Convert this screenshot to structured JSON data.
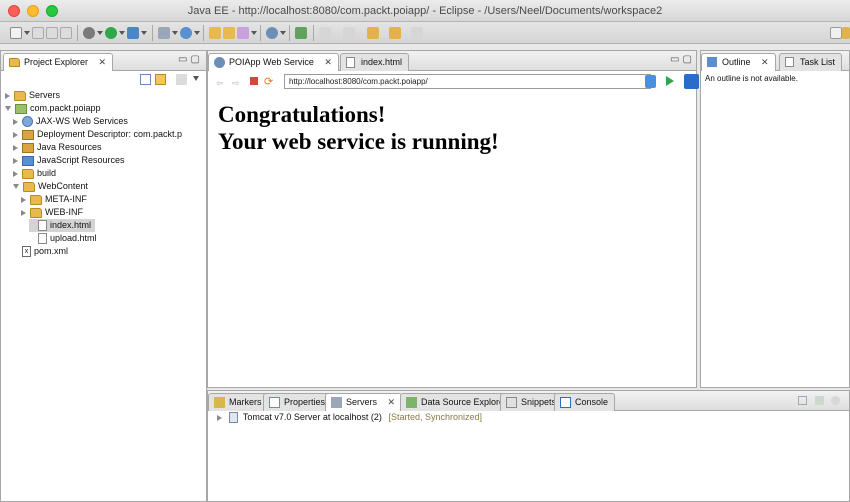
{
  "window": {
    "title": "Java EE - http://localhost:8080/com.packt.poiapp/ - Eclipse - /Users/Neel/Documents/workspace2"
  },
  "project_explorer": {
    "tab_label": "Project Explorer",
    "tree": [
      {
        "label": "Servers",
        "icon": "folder-icon",
        "indent": 0,
        "state": "closed"
      },
      {
        "label": "com.packt.poiapp",
        "icon": "project-icon",
        "indent": 0,
        "state": "open"
      },
      {
        "label": "JAX-WS Web Services",
        "icon": "web-services-icon",
        "indent": 1,
        "state": "closed"
      },
      {
        "label": "Deployment Descriptor: com.packt.p",
        "icon": "deployment-descriptor-icon",
        "indent": 1,
        "state": "closed"
      },
      {
        "label": "Java Resources",
        "icon": "java-resources-icon",
        "indent": 1,
        "state": "closed"
      },
      {
        "label": "JavaScript Resources",
        "icon": "javascript-resources-icon",
        "indent": 1,
        "state": "closed"
      },
      {
        "label": "build",
        "icon": "folder-icon",
        "indent": 1,
        "state": "closed"
      },
      {
        "label": "WebContent",
        "icon": "folder-icon",
        "indent": 1,
        "state": "open"
      },
      {
        "label": "META-INF",
        "icon": "folder-icon",
        "indent": 2,
        "state": "closed"
      },
      {
        "label": "WEB-INF",
        "icon": "folder-icon",
        "indent": 2,
        "state": "closed"
      },
      {
        "label": "index.html",
        "icon": "html-file-icon",
        "indent": 3,
        "state": "leaf",
        "selected": true
      },
      {
        "label": "upload.html",
        "icon": "html-file-icon",
        "indent": 3,
        "state": "leaf"
      },
      {
        "label": "pom.xml",
        "icon": "xml-file-icon",
        "indent": 1,
        "state": "leaf"
      }
    ]
  },
  "editor": {
    "tabs": [
      {
        "label": "POIApp Web Service",
        "active": true
      },
      {
        "label": "index.html",
        "active": false
      }
    ],
    "url": "http://localhost:8080/com.packt.poiapp/",
    "heading_line1": "Congratulations!",
    "heading_line2": "Your web service is running!"
  },
  "outline": {
    "tabs": [
      {
        "label": "Outline",
        "active": true
      },
      {
        "label": "Task List",
        "active": false
      }
    ],
    "message": "An outline is not available."
  },
  "bottom_panel": {
    "tabs": [
      {
        "label": "Markers",
        "active": false
      },
      {
        "label": "Properties",
        "active": false
      },
      {
        "label": "Servers",
        "active": true
      },
      {
        "label": "Data Source Explorer",
        "active": false
      },
      {
        "label": "Snippets",
        "active": false
      },
      {
        "label": "Console",
        "active": false
      }
    ],
    "server": {
      "name": "Tomcat v7.0 Server at localhost (2)",
      "state": "[Started, Synchronized]"
    }
  },
  "colors": {
    "selection": "#d4d4d4",
    "active_tab": "#ffffff",
    "server_state": "#8a7a46"
  }
}
